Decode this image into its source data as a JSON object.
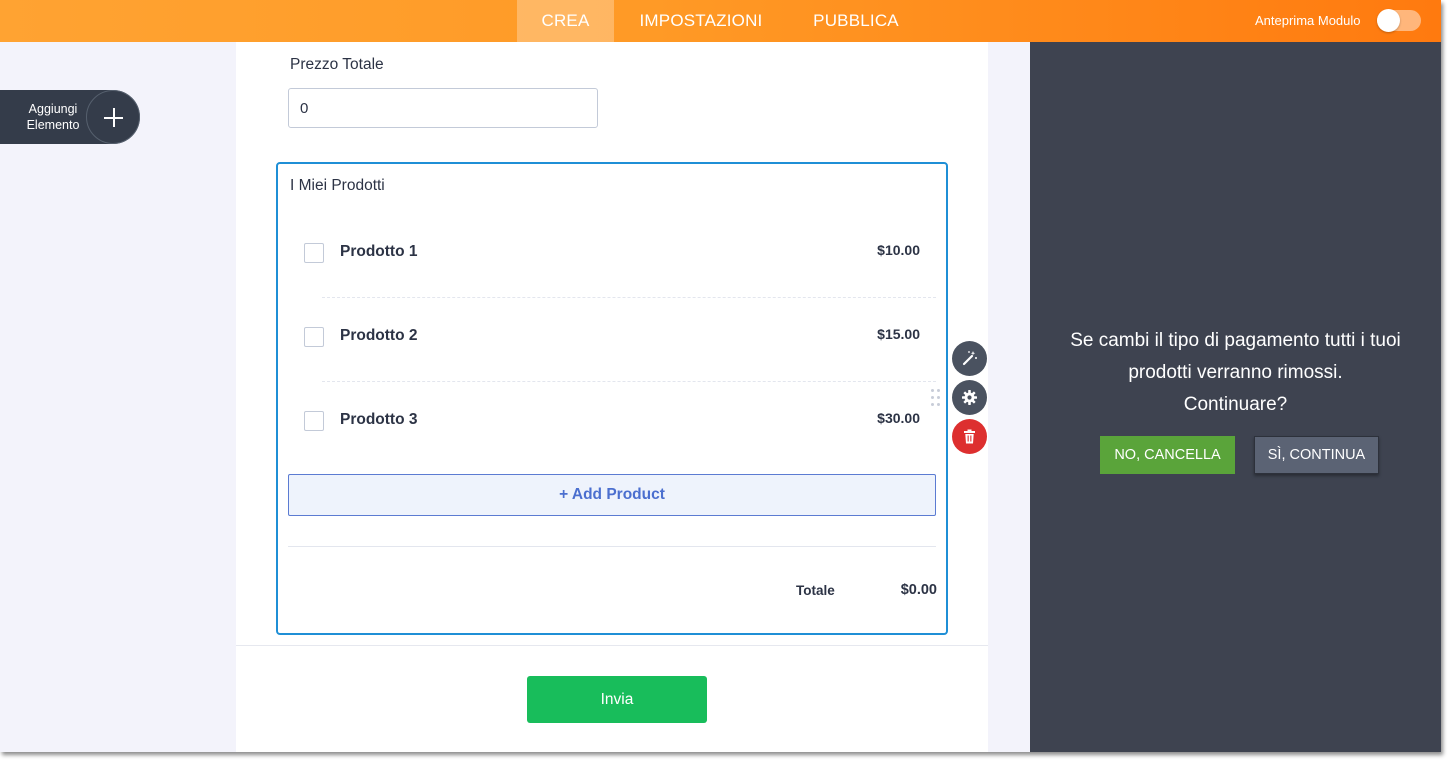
{
  "header": {
    "tabs": [
      {
        "label": "CREA",
        "active": true
      },
      {
        "label": "IMPOSTAZIONI",
        "active": false
      },
      {
        "label": "PUBBLICA",
        "active": false
      }
    ],
    "preview_label": "Anteprima Modulo",
    "preview_enabled": false,
    "gradient_colors": [
      "#ffa332",
      "#ff7a0f"
    ]
  },
  "sidebar": {
    "add_element_line1": "Aggiungi",
    "add_element_line2": "Elemento",
    "add_icon": "plus-icon"
  },
  "form": {
    "total_price_label": "Prezzo Totale",
    "total_price_value": "0",
    "products_title": "I Miei Prodotti",
    "products": [
      {
        "name": "Prodotto 1",
        "price": "$10.00",
        "checked": false
      },
      {
        "name": "Prodotto 2",
        "price": "$15.00",
        "checked": false
      },
      {
        "name": "Prodotto 3",
        "price": "$30.00",
        "checked": false
      }
    ],
    "add_product_label": "+ Add Product",
    "total_label": "Totale",
    "total_value": "$0.00",
    "submit_label": "Invia",
    "accent_color": "#1f8fd6",
    "submit_color": "#18bd5b"
  },
  "tools": {
    "wand_icon": "magic-wand-icon",
    "settings_icon": "gear-icon",
    "delete_icon": "trash-icon"
  },
  "panel": {
    "message_lines": [
      "Se cambi il tipo di pagamento tutti i tuoi",
      "prodotti verranno rimossi.",
      "Continuare?"
    ],
    "cancel_label": "NO, CANCELLA",
    "continue_label": "SÌ, CONTINUA",
    "background_color": "#3e4350",
    "cancel_color": "#5aa43a"
  }
}
